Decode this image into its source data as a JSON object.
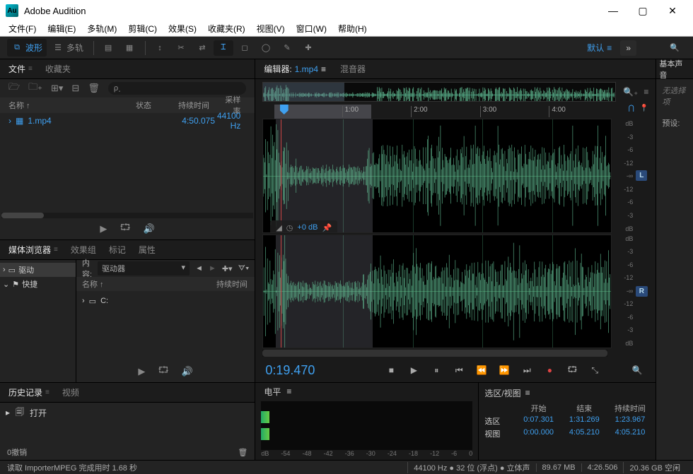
{
  "app": {
    "title": "Adobe Audition",
    "icon_text": "Au"
  },
  "menu": [
    "文件(F)",
    "编辑(E)",
    "多轨(M)",
    "剪辑(C)",
    "效果(S)",
    "收藏夹(R)",
    "视图(V)",
    "窗口(W)",
    "帮助(H)"
  ],
  "toolbar": {
    "waveform": "波形",
    "multitrack": "多轨",
    "workspace": "默认"
  },
  "files_panel": {
    "tab_files": "文件",
    "tab_fav": "收藏夹",
    "search_placeholder": "ρ˯",
    "col_name": "名称 ↑",
    "col_status": "状态",
    "col_duration": "持续时间",
    "col_rate": "采样率",
    "rows": [
      {
        "name": "1.mp4",
        "duration": "4:50.075",
        "rate": "44100 Hz"
      }
    ]
  },
  "media_panel": {
    "tab_browser": "媒体浏览器",
    "tab_fxgroup": "效果组",
    "tab_markers": "标记",
    "tab_props": "属性",
    "content_label": "内容:",
    "dropdown_value": "驱动器",
    "col_name": "名称 ↑",
    "col_duration": "持续时间",
    "tree": [
      {
        "label": "驱动",
        "icon": "drive"
      },
      {
        "label": "快捷",
        "icon": "shortcut"
      }
    ],
    "items": [
      {
        "label": "C:"
      }
    ]
  },
  "history_panel": {
    "tab_history": "历史记录",
    "tab_video": "视频",
    "rows": [
      {
        "label": "打开"
      }
    ],
    "footer": "0撤销"
  },
  "editor": {
    "tab_editor_prefix": "编辑器:",
    "tab_editor_file": "1.mp4",
    "tab_mixer": "混音器",
    "ruler_ticks": [
      {
        "pos": 23,
        "label": "1:00"
      },
      {
        "pos": 43,
        "label": "2:00"
      },
      {
        "pos": 63,
        "label": "3:00"
      },
      {
        "pos": 83,
        "label": "4:00"
      }
    ],
    "db_ticks": [
      "dB",
      "-3",
      "-6",
      "-12",
      "-∞",
      "-12",
      "-6",
      "-3",
      "dB"
    ],
    "hud_gain": "+0 dB",
    "ch_left": "L",
    "ch_right": "R",
    "timecode": "0:19.470"
  },
  "levels_panel": {
    "title": "电平",
    "scale": [
      "dB",
      "-54",
      "-48",
      "-42",
      "-36",
      "-30",
      "-24",
      "-18",
      "-12",
      "-6",
      "0"
    ]
  },
  "selection_panel": {
    "title": "选区/视图",
    "hdr_start": "开始",
    "hdr_end": "结束",
    "hdr_dur": "持续时间",
    "row_sel": "选区",
    "row_view": "视图",
    "sel": {
      "start": "0:07.301",
      "end": "1:31.269",
      "dur": "1:23.967"
    },
    "view": {
      "start": "0:00.000",
      "end": "4:05.210",
      "dur": "4:05.210"
    }
  },
  "right_panel": {
    "title": "基本声音",
    "no_selection": "无选择项",
    "preset": "预设:"
  },
  "status": {
    "left": "读取 ImporterMPEG 完成用时 1.68 秒",
    "items": [
      "44100 Hz ● 32 位 (浮点) ● 立体声",
      "89.67 MB",
      "4:26.506",
      "20.36 GB 空闲"
    ]
  }
}
